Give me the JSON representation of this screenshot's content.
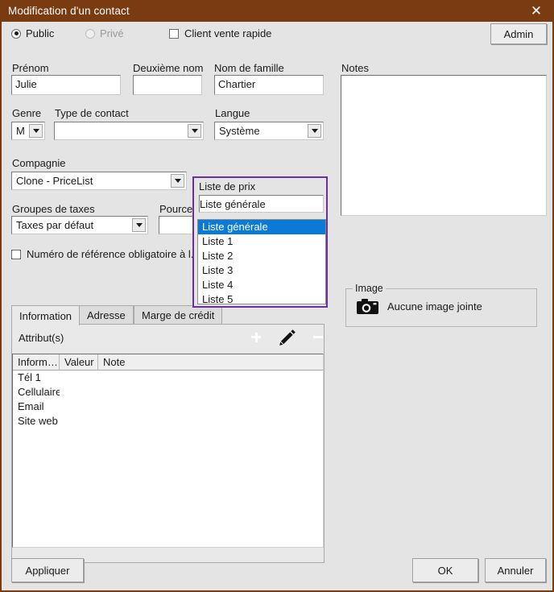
{
  "window": {
    "title": "Modification d'un contact",
    "close_icon": "close-icon"
  },
  "top_bar": {
    "public_label": "Public",
    "private_label": "Privé",
    "quick_sale_label": "Client vente rapide",
    "admin_label": "Admin"
  },
  "fields": {
    "first_name": {
      "label": "Prénom",
      "value": "Julie"
    },
    "middle_name": {
      "label": "Deuxième nom",
      "value": ""
    },
    "last_name": {
      "label": "Nom de famille",
      "value": "Chartier"
    },
    "gender": {
      "label": "Genre",
      "value": "M"
    },
    "contact_type": {
      "label": "Type de contact",
      "value": ""
    },
    "language": {
      "label": "Langue",
      "value": "Système"
    },
    "company": {
      "label": "Compagnie",
      "value": "Clone - PriceList"
    },
    "tax_groups": {
      "label": "Groupes de taxes",
      "value": "Taxes par défaut"
    },
    "percentage": {
      "label": "Pource",
      "value": ""
    },
    "reference_required": {
      "label": "Numéro de référence obligatoire à l."
    }
  },
  "price_list": {
    "label": "Liste de prix",
    "selected": "Liste générale",
    "options": [
      "Liste générale",
      "Liste 1",
      "Liste 2",
      "Liste 3",
      "Liste 4",
      "Liste 5"
    ],
    "highlight_color": "#0a7ad6",
    "focus_border_color": "#6a2fa0"
  },
  "notes": {
    "label": "Notes",
    "value": ""
  },
  "image": {
    "group_label": "Image",
    "camera_icon": "camera-icon",
    "text": "Aucune image jointe"
  },
  "tabs": [
    {
      "label": "Information",
      "active": true
    },
    {
      "label": "Adresse",
      "active": false
    },
    {
      "label": "Marge de crédit",
      "active": false
    }
  ],
  "attributes": {
    "section_label": "Attribut(s)",
    "add_icon": "plus-circle-icon",
    "edit_icon": "pencil-icon",
    "remove_icon": "minus-circle-icon",
    "columns": [
      "Inform…",
      "Valeur",
      "Note"
    ],
    "rows": [
      {
        "information": "Tél 1",
        "valeur": "",
        "note": ""
      },
      {
        "information": "Cellulaire",
        "valeur": "",
        "note": ""
      },
      {
        "information": "Email",
        "valeur": "",
        "note": ""
      },
      {
        "information": "Site web",
        "valeur": "",
        "note": ""
      }
    ]
  },
  "footer": {
    "apply_label": "Appliquer",
    "ok_label": "OK",
    "cancel_label": "Annuler"
  }
}
